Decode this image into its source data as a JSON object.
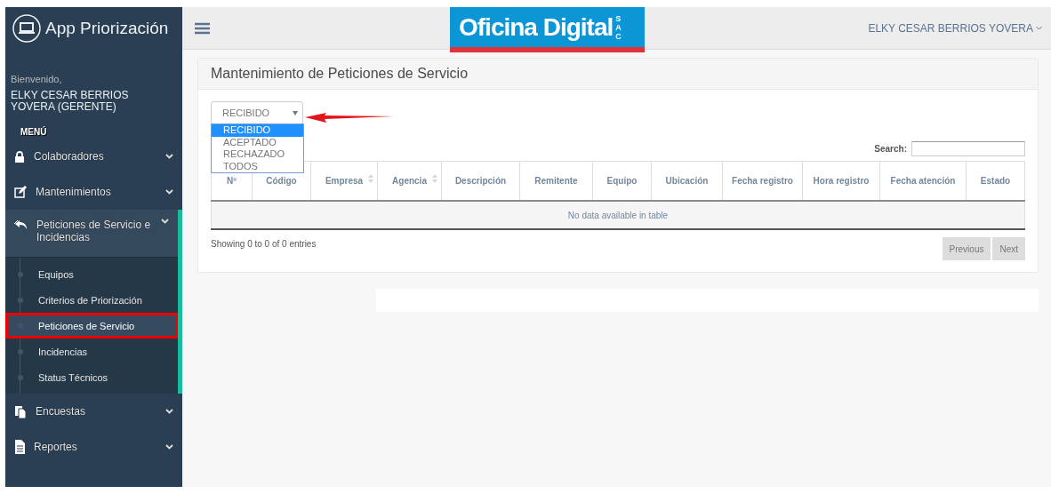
{
  "sidebar": {
    "brand": "App Priorización",
    "welcome": "Bienvenido,",
    "user": "ELKY CESAR BERRIOS YOVERA (GERENTE)",
    "menu_title": "MENÚ",
    "items": [
      {
        "label": "Colaboradores",
        "kind": "lock",
        "expanded": false
      },
      {
        "label": "Mantenimientos",
        "kind": "edit",
        "expanded": false
      },
      {
        "label": "Peticiones de Servicio e Incidencias",
        "kind": "reply",
        "expanded": true,
        "children": [
          {
            "label": "Equipos",
            "selected": false
          },
          {
            "label": "Criterios de Priorización",
            "selected": false
          },
          {
            "label": "Peticiones de Servicio",
            "selected": true
          },
          {
            "label": "Incidencias",
            "selected": false
          },
          {
            "label": "Status Técnicos",
            "selected": false
          }
        ]
      },
      {
        "label": "Encuestas",
        "kind": "copy",
        "expanded": false
      },
      {
        "label": "Reportes",
        "kind": "file",
        "expanded": false
      }
    ]
  },
  "topbar": {
    "logo": "Oficina Digital",
    "logo_suffix": "SAC",
    "user_menu": "ELKY CESAR BERRIOS YOVERA"
  },
  "panel": {
    "title": "Mantenimiento de Peticiones de Servicio",
    "filter": {
      "value": "RECIBIDO",
      "open": true,
      "options": [
        {
          "label": "RECIBIDO",
          "selected": true
        },
        {
          "label": "ACEPTADO",
          "selected": false
        },
        {
          "label": "RECHAZADO",
          "selected": false
        },
        {
          "label": "TODOS",
          "selected": false
        }
      ]
    },
    "search_label": "Search:",
    "table": {
      "columns": [
        {
          "label": "Nº",
          "sortable": false
        },
        {
          "label": "Código",
          "sortable": false
        },
        {
          "label": "Empresa",
          "sortable": true
        },
        {
          "label": "Agencia",
          "sortable": true
        },
        {
          "label": "Descripción",
          "sortable": false
        },
        {
          "label": "Remitente",
          "sortable": false
        },
        {
          "label": "Equipo",
          "sortable": false
        },
        {
          "label": "Ubicación",
          "sortable": false
        },
        {
          "label": "Fecha registro",
          "sortable": false
        },
        {
          "label": "Hora registro",
          "sortable": false
        },
        {
          "label": "Fecha atención",
          "sortable": false
        },
        {
          "label": "Estado",
          "sortable": false
        }
      ],
      "empty_message": "No data available in table"
    },
    "info": "Showing 0 to 0 of 0 entries",
    "pagination": [
      {
        "label": "Previous",
        "disabled": true
      },
      {
        "label": "Next",
        "disabled": true
      }
    ]
  }
}
